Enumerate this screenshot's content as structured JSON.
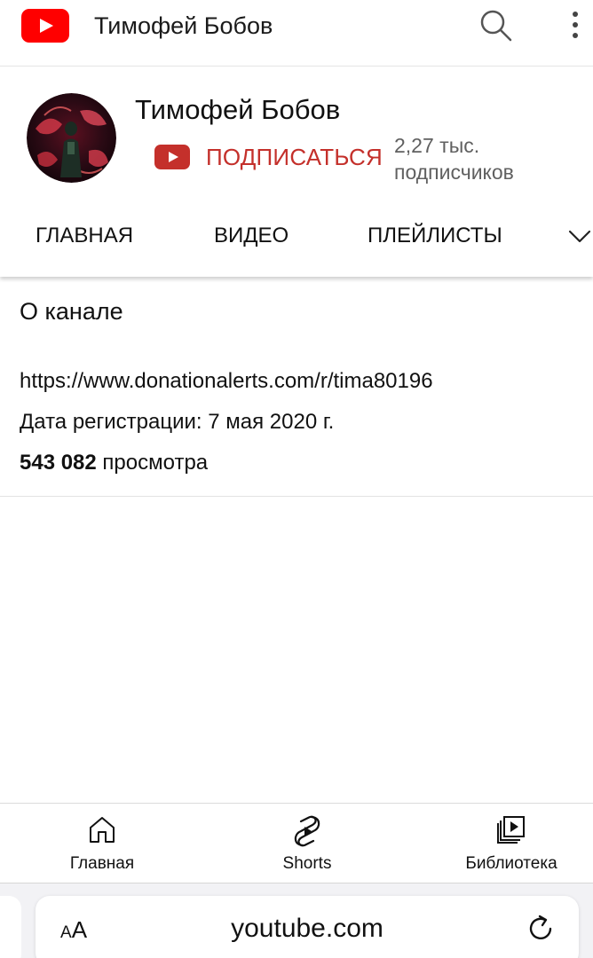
{
  "topbar": {
    "title": "Тимофей Бобов",
    "logo_icon": "youtube-logo-icon",
    "search_icon": "search-icon",
    "more_icon": "more-vertical-icon"
  },
  "channel": {
    "name": "Тимофей Бобов",
    "subscribe_label": "ПОДПИСАТЬСЯ",
    "subscribers_line1": "2,27 тыс.",
    "subscribers_line2": "подписчиков"
  },
  "tabs": [
    {
      "label": "ГЛАВНАЯ"
    },
    {
      "label": "ВИДЕО"
    },
    {
      "label": "ПЛЕЙЛИСТЫ"
    }
  ],
  "about": {
    "title": "О канале",
    "link": "https://www.donationalerts.com/r/tima80196",
    "registration_date": "Дата регистрации: 7 мая 2020 г.",
    "views_count": "543 082",
    "views_label": " просмотра"
  },
  "bottom_nav": [
    {
      "label": "Главная",
      "icon": "home-icon"
    },
    {
      "label": "Shorts",
      "icon": "shorts-icon"
    },
    {
      "label": "Библиотека",
      "icon": "library-icon"
    }
  ],
  "browser": {
    "text_size_small": "A",
    "text_size_large": "A",
    "url": "youtube.com"
  },
  "colors": {
    "brand_red": "#ff0000",
    "subscribe_red": "#c4302b",
    "secondary_text": "#606060"
  }
}
